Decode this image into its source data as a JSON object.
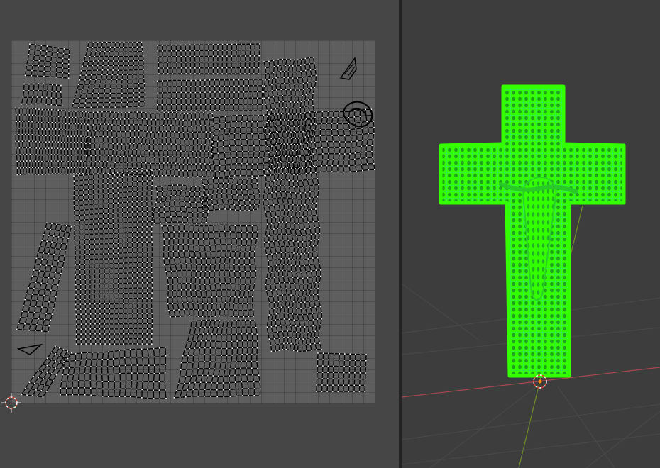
{
  "uv_editor": {
    "panel": "uv-editor",
    "grid": "uv-grid",
    "cursor_icon": "2d-cursor-icon"
  },
  "viewport_3d": {
    "panel": "3d-viewport",
    "object": "crucifix-mesh-wireframe",
    "colors": {
      "background": "#3d3d3d",
      "mesh_selected": "#33ff00",
      "wire_edges": "#2ec7d6",
      "x_axis": "#a8484f",
      "y_axis": "#6f8e2b",
      "origin_cursor": "#ff8a00"
    }
  },
  "colors": {
    "uv_background": "#464646",
    "uv_grid": "#5e5e5e",
    "uv_wire": "#000000",
    "uv_vertex": "#ffffff",
    "divider": "#232323"
  }
}
